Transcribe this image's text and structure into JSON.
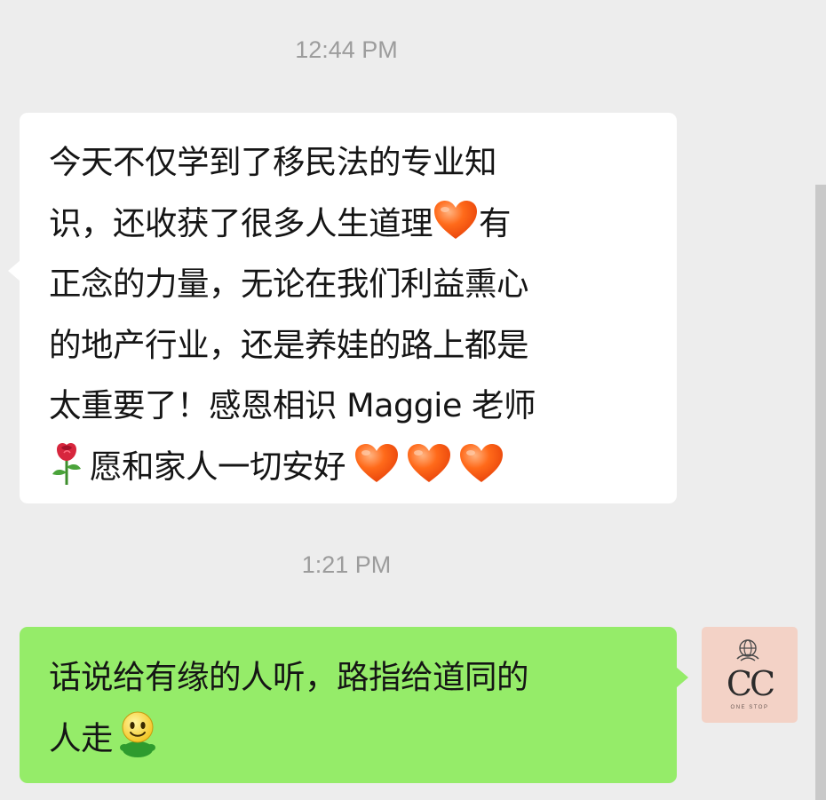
{
  "chat": {
    "timestamps": [
      "12:44 PM",
      "1:21 PM"
    ],
    "incoming": {
      "lines": [
        "今天不仅学到了移民法的专业知",
        "识，还收获了很多人生道理",
        "有",
        "正念的力量，无论在我们利益熏心",
        "的地产行业，还是养娃的路上都是",
        "太重要了！感恩相识 Maggie 老师",
        "愿和家人一切安好"
      ],
      "emoji": [
        "orange-heart",
        "rose",
        "orange-heart"
      ]
    },
    "outgoing": {
      "lines": [
        "话说给有缘的人听，路指给道同的",
        "人走"
      ],
      "emoji": [
        "smiley-figure"
      ]
    }
  },
  "avatar": {
    "text": "CC",
    "subtext": "ONE STOP"
  },
  "colors": {
    "background": "#ededed",
    "incoming_bubble": "#ffffff",
    "outgoing_bubble": "#95ec69",
    "heart": "#ff6a1a",
    "avatar_bg": "#f3d2c6"
  }
}
